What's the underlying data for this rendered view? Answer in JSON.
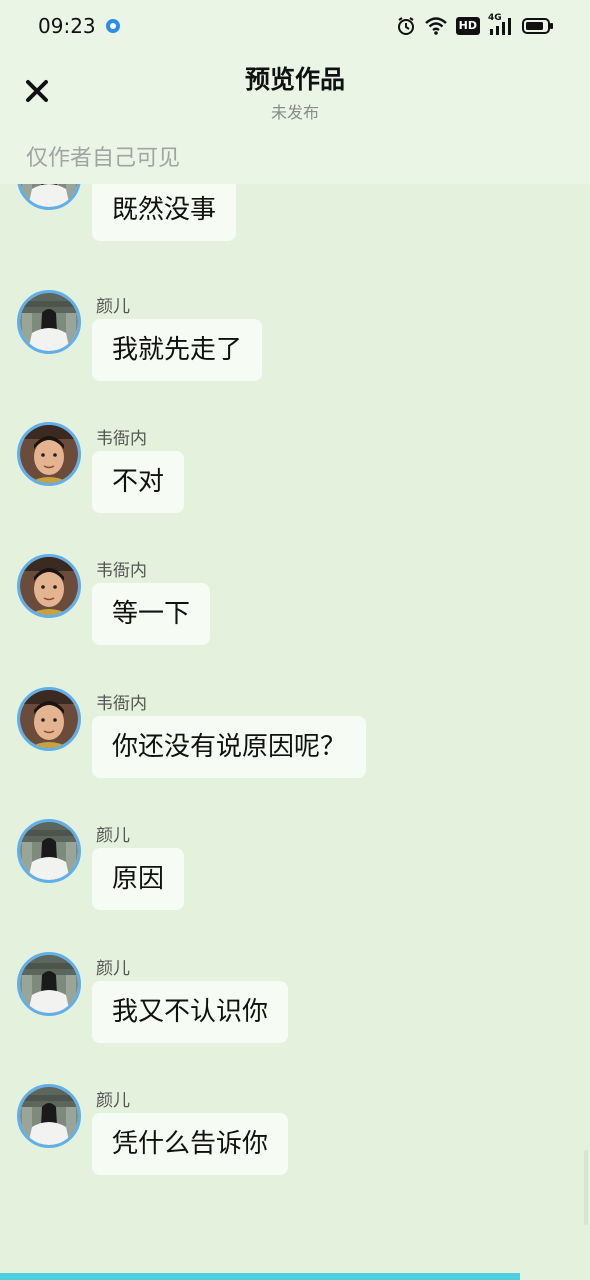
{
  "status_bar": {
    "time": "09:23",
    "icons": [
      "notification-dot-icon",
      "alarm-icon",
      "wifi-icon",
      "hd-icon",
      "signal-4g-icon",
      "battery-icon"
    ],
    "hd_label": "HD",
    "network_label": "4G"
  },
  "header": {
    "close_icon": "close-icon",
    "title": "预览作品",
    "subtitle": "未发布",
    "visibility_note": "仅作者自己可见"
  },
  "messages": [
    {
      "sender": "",
      "text": "既然没事",
      "avatar": "girl"
    },
    {
      "sender": "颜儿",
      "text": "我就先走了",
      "avatar": "girl"
    },
    {
      "sender": "韦衙内",
      "text": "不对",
      "avatar": "man"
    },
    {
      "sender": "韦衙内",
      "text": "等一下",
      "avatar": "man"
    },
    {
      "sender": "韦衙内",
      "text": "你还没有说原因呢？",
      "avatar": "man"
    },
    {
      "sender": "颜儿",
      "text": "原因",
      "avatar": "girl"
    },
    {
      "sender": "颜儿",
      "text": "我又不认识你",
      "avatar": "girl"
    },
    {
      "sender": "颜儿",
      "text": "凭什么告诉你",
      "avatar": "girl"
    }
  ],
  "colors": {
    "background": "#e4f2dd",
    "header_bg": "#ebf5e6",
    "bubble": "#f6fbf4",
    "avatar_border": "#5fb0ea",
    "progress": "#4fd0dc"
  }
}
